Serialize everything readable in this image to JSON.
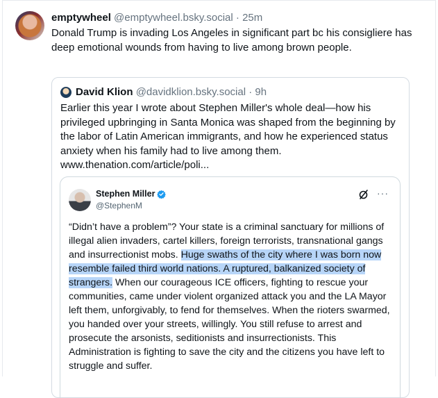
{
  "post": {
    "author": "emptywheel",
    "handle": "@emptywheel.bsky.social",
    "separator": "·",
    "time": "25m",
    "text": "Donald Trump is invading Los Angeles in significant part bc his consigliere has deep emotional wounds from having to live among brown people."
  },
  "quote": {
    "author": "David Klion",
    "handle": "@davidklion.bsky.social",
    "separator": "·",
    "time": "9h",
    "text": "Earlier this year I wrote about Stephen Miller's whole deal—how his privileged upbringing in Santa Monica was shaped from the beginning by the labor of Latin American immigrants, and how he experienced status anxiety when his family had to live among them. www.thenation.com/article/poli..."
  },
  "embed": {
    "name": "Stephen Miller",
    "handle": "@StephenM",
    "text_before": "“Didn’t have a problem”? Your state is a criminal sanctuary for millions of illegal alien invaders, cartel killers, foreign terrorists, transnational gangs and insurrectionist mobs. ",
    "text_highlight": "Huge swaths of the city where I was born now resemble failed third world nations. A ruptured, balkanized society of strangers.",
    "text_after": " When our courageous ICE officers, fighting to rescue your communities, came under violent organized attack you and the LA Mayor left them, unforgivably, to fend for themselves. When the rioters swarmed, you handed over your streets, willingly. You still refuse to arrest and prosecute the arsonists, seditionists and insurrectionists. This Administration is fighting to save the city and the citizens you have left to struggle and suffer.",
    "more_glyph": "···",
    "highlight_color": "#b7d5f8",
    "verified_color": "#1d9bf0"
  },
  "icons": {
    "avatar": "profile-photo",
    "verified": "verified-badge-icon",
    "grok": "grok-icon",
    "more": "more-options-icon"
  }
}
